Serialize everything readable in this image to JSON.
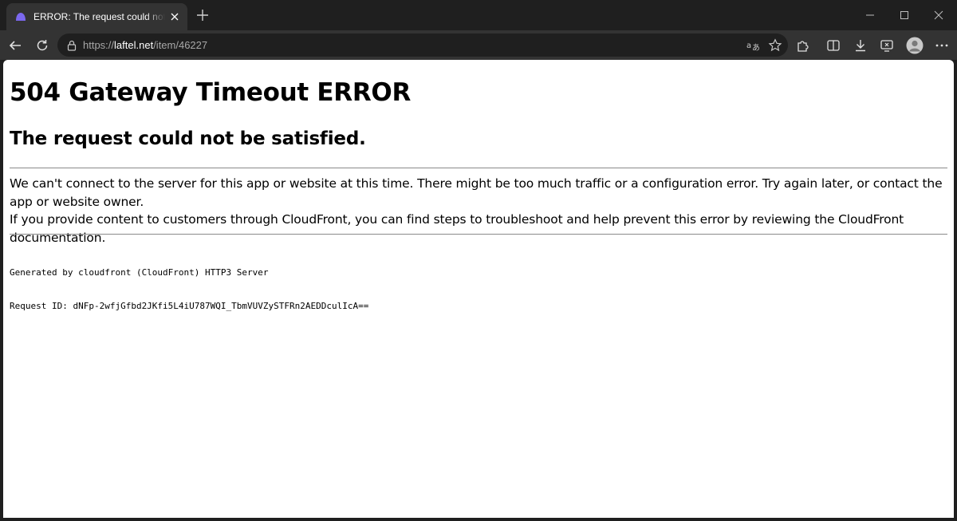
{
  "browser": {
    "tab": {
      "title": "ERROR: The request could not be satisfied",
      "favicon": "laftel-favicon-icon"
    },
    "address_bar": {
      "scheme": "https://",
      "host": "laftel.net",
      "path": "/item/46227"
    },
    "icons": {
      "back": "back-arrow-icon",
      "refresh": "refresh-icon",
      "lock": "lock-icon",
      "translate": "translate-icon",
      "favorite": "star-icon",
      "extensions": "puzzle-icon",
      "split_screen": "split-screen-icon",
      "downloads": "download-icon",
      "screenshot": "screenshot-icon",
      "profile": "avatar-icon",
      "menu": "more-icon",
      "minimize": "minimize-icon",
      "maximize": "maximize-icon",
      "close": "close-icon"
    },
    "colors": {
      "frame": "#1f1f1f",
      "toolbar": "#333333",
      "favicon_accent": "#7b68ee"
    }
  },
  "page": {
    "title": "504 Gateway Timeout ERROR",
    "subtitle": "The request could not be satisfied.",
    "message_1": "We can't connect to the server for this app or website at this time. There might be too much traffic or a configuration error. Try again later, or contact the app or website owner.",
    "message_2": "If you provide content to customers through CloudFront, you can find steps to troubleshoot and help prevent this error by reviewing the CloudFront documentation.",
    "generated_by": "Generated by cloudfront (CloudFront) HTTP3 Server",
    "request_id": "Request ID: dNFp-2wfjGfbd2JKfi5L4iU787WQI_TbmVUVZySTFRn2AEDDculIcA=="
  }
}
